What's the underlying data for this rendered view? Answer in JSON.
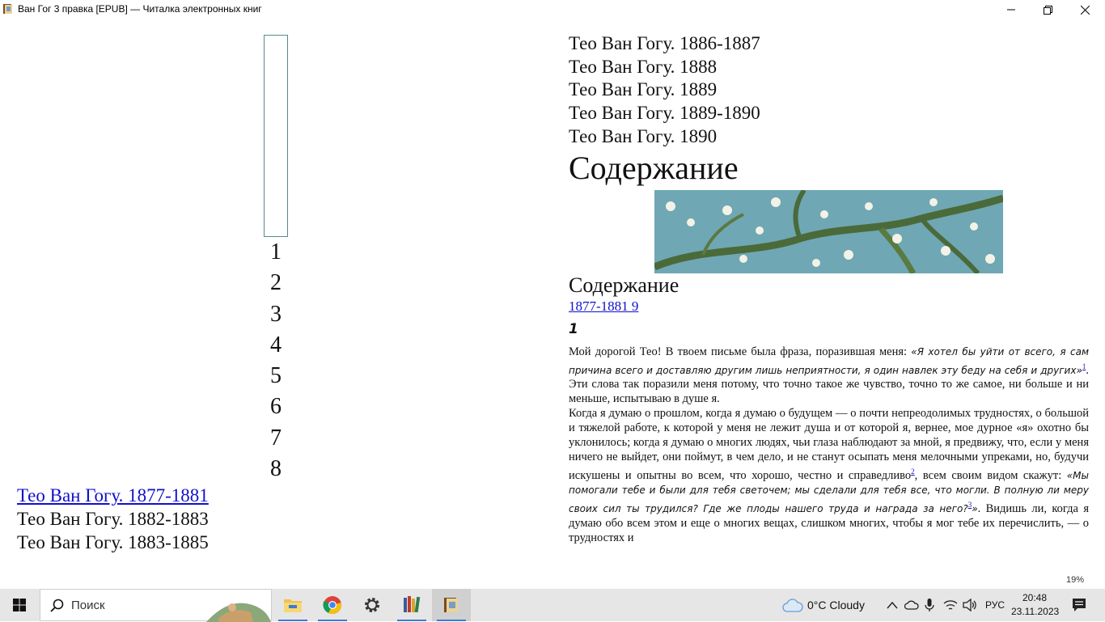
{
  "window": {
    "title": "Ван Гог 3 правка [EPUB] — Читалка электронных книг"
  },
  "left_page": {
    "page_numbers": [
      "1",
      "2",
      "3",
      "4",
      "5",
      "6",
      "7",
      "8"
    ],
    "links": [
      {
        "label": "Тео Ван Гогу. 1877-1881",
        "is_link": true
      },
      {
        "label": "Тео Ван Гогу. 1882-1883",
        "is_link": false
      },
      {
        "label": "Тео Ван Гогу. 1883-1885",
        "is_link": false
      }
    ]
  },
  "right_page": {
    "toc_items": [
      "Тео Ван Гогу. 1886-1887",
      "Тео Ван Гогу. 1888",
      "Тео Ван Гогу. 1889",
      "Тео Ван Гогу. 1889-1890",
      "Тео Ван Гогу. 1890"
    ],
    "toc_heading_large": "Содержание",
    "toc_heading_small": "Содержание",
    "toc_link": "1877-1881 9",
    "chapter_number": "1",
    "para1_start": "Мой дорогой Тео! В твоем письме была фраза, поразившая меня: ",
    "para1_quote": "«Я хотел бы уйти от всего, я сам причина всего и доставляю другим лишь неприятности, я один навлек эту беду на себя и других»",
    "para1_fn": "1",
    "para1_end": ". Эти слова так поразили меня потому, что точно такое же чувство, точно то же самое, ни больше и ни меньше, испытываю в душе я.",
    "para2_start": "Когда я думаю о прошлом, когда я думаю о будущем — о почти непреодолимых трудностях, о большой и тяжелой работе, к которой у меня не лежит душа и от которой я, вернее, мое дурное «я» охотно бы уклонилось; когда я думаю о многих людях, чьи глаза наблюдают за мной, я предвижу, что, если у меня ничего не выйдет, они поймут, в чем дело, и не станут осыпать меня мелочными упреками, но, будучи искушены и опытны во всем, что хорошо, честно и справедливо",
    "para2_fn1": "2",
    "para2_mid": ", всем своим видом скажут: ",
    "para2_quote": "«Мы помогали тебе и были для тебя светочем; мы сделали для тебя все, что могли. В полную ли меру своих сил ты трудился? Где же плоды нашего труда и награда за него?",
    "para2_fn2": "3",
    "para2_quote_end": "»",
    "para2_end": ". Видишь ли, когда я думаю обо всем этом и еще о многих вещах, слишком многих, чтобы я мог тебе их перечислить, — о трудностях и"
  },
  "reader": {
    "progress": "19%"
  },
  "taskbar": {
    "search_placeholder": "Поиск",
    "weather": "0°C  Cloudy",
    "language": "РУС",
    "time": "20:48",
    "date": "23.11.2023"
  }
}
